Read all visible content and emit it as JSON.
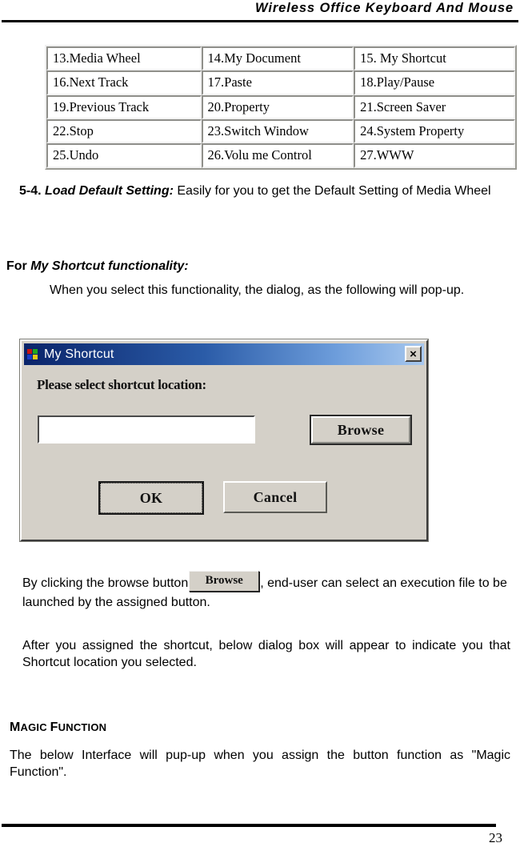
{
  "header": {
    "title": "Wireless Office Keyboard And Mouse"
  },
  "function_table": {
    "rows": [
      [
        "13.Media Wheel",
        "14.My Document",
        "15. My Shortcut"
      ],
      [
        "16.Next Track",
        "17.Paste",
        "18.Play/Pause"
      ],
      [
        "19.Previous Track",
        "20.Property",
        "21.Screen Saver"
      ],
      [
        "22.Stop",
        "23.Switch Window",
        "24.System Property"
      ],
      [
        "25.Undo",
        "26.Volu me Control",
        "27.WWW"
      ]
    ]
  },
  "sections": {
    "load_default": {
      "number": "5-4.",
      "title": "Load Default Setting:",
      "body": "Easily for you to get the Default Setting of Media Wheel"
    },
    "my_shortcut": {
      "lead_prefix": "For ",
      "lead_title": "My Shortcut functionality:",
      "body": "When you select this functionality, the dialog, as the following will pop-up."
    },
    "browse_paragraph": {
      "before": "By clicking the browse button",
      "inline_button_label": "Browse",
      "after": ", end-user can select an execution file to be launched by the assigned button."
    },
    "after_assign_paragraph": "After you assigned the shortcut, below dialog box will appear to indicate you that Shortcut location you selected.",
    "magic_function": {
      "heading_first": "M",
      "heading_rest_a": "AGIC ",
      "heading_second": "F",
      "heading_rest_b": "UNCTION",
      "body": "The below Interface will pup-up when you assign the button function as \"Magic Function\"."
    }
  },
  "dialog": {
    "title": "My Shortcut",
    "close_label": "×",
    "prompt": "Please select shortcut location:",
    "path_value": "",
    "path_placeholder": "",
    "buttons": {
      "browse": "Browse",
      "ok": "OK",
      "cancel": "Cancel"
    }
  },
  "footer": {
    "page_number": "23"
  },
  "colors": {
    "titlebar_start": "#0a246a",
    "titlebar_end": "#a8c8ee",
    "dialog_face": "#d4d0c8",
    "text": "#000000"
  }
}
